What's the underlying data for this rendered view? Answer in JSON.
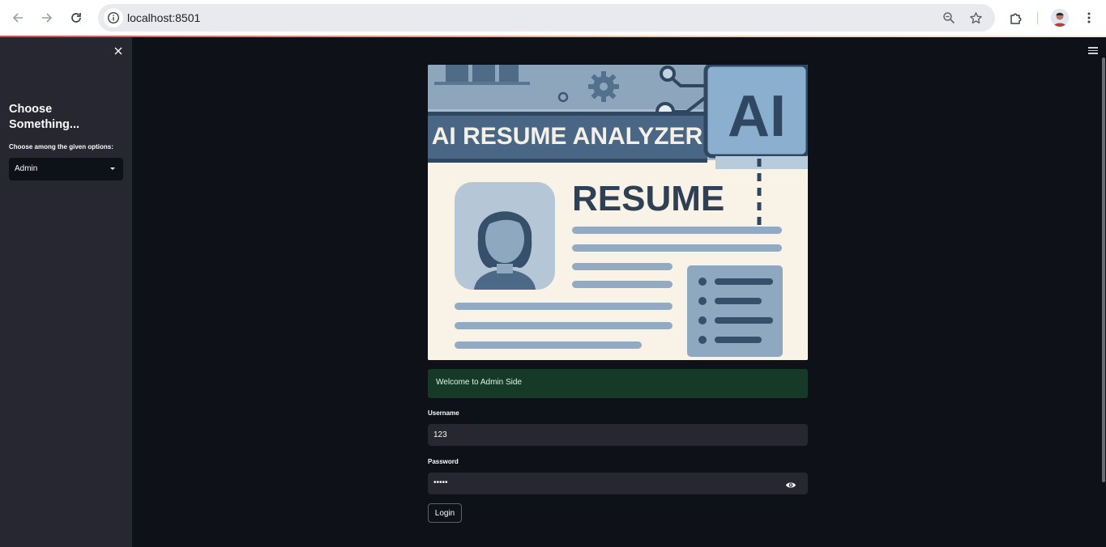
{
  "browser": {
    "url": "localhost:8501",
    "icons": [
      "back-arrow-icon",
      "forward-arrow-icon",
      "reload-icon",
      "site-info-icon",
      "zoom-icon",
      "bookmark-star-icon",
      "extensions-icon",
      "profile-avatar",
      "more-menu-icon"
    ]
  },
  "sidebar": {
    "title": "Choose Something...",
    "select_label": "Choose among the given options:",
    "selected": "Admin"
  },
  "banner": {
    "headline": "AI RESUME ANALYZER",
    "badge": "AI",
    "doc_title": "RESUME"
  },
  "alert": {
    "text": "Welcome to Admin Side"
  },
  "form": {
    "username_label": "Username",
    "username_value": "123",
    "password_label": "Password",
    "password_value": "•••••",
    "login_label": "Login"
  },
  "colors": {
    "app_bg": "#0e1117",
    "sidebar_bg": "#262730",
    "success_bg": "#173928",
    "banner_blue": "#36506b"
  }
}
